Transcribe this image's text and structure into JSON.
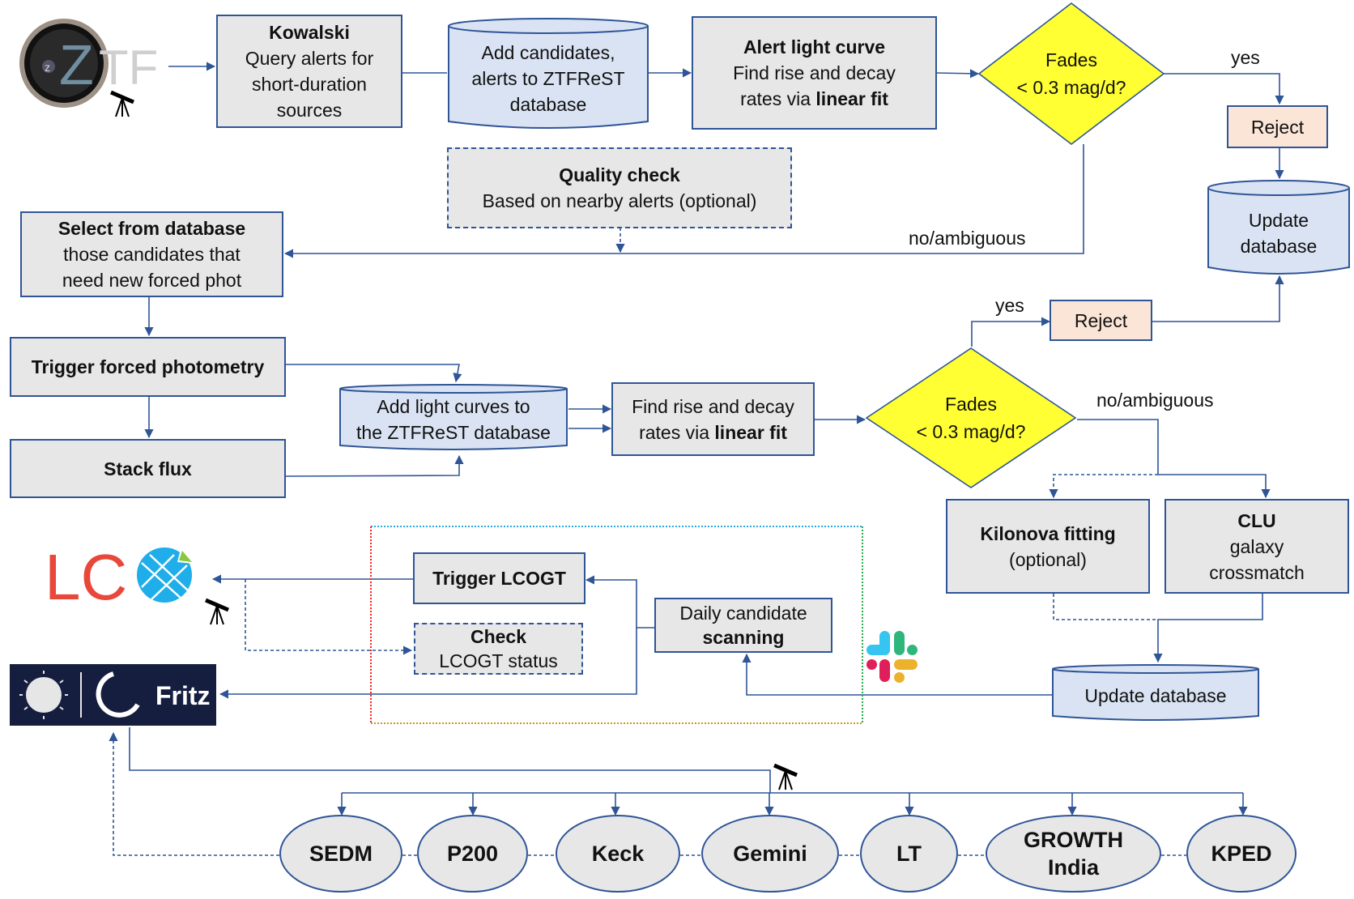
{
  "logos": {
    "ztf": {
      "name": "ZTF",
      "text_main": "Z",
      "text_rest": "TF",
      "text_small": "z"
    },
    "lco": {
      "name": "LCO",
      "text": "LC"
    },
    "fritz": {
      "name": "Fritz",
      "text": "Fritz"
    },
    "slack": {
      "name": "Slack"
    }
  },
  "nodes": {
    "kowalski": {
      "title": "Kowalski",
      "lines": [
        "Query alerts for",
        "short-duration",
        "sources"
      ]
    },
    "add_candidates": {
      "lines": [
        "Add candidates,",
        "alerts to ZTFReST",
        "database"
      ]
    },
    "alert_light_curve": {
      "title": "Alert light curve",
      "line1": "Find rise and decay",
      "line2_prefix": "rates via ",
      "line2_bold": "linear fit"
    },
    "decision_top": {
      "line1": "Fades",
      "line2": "< 0.3 mag/d?"
    },
    "reject_top": {
      "label": "Reject"
    },
    "update_db_top": {
      "lines": [
        "Update",
        "database"
      ]
    },
    "quality_check": {
      "title": "Quality check",
      "subtitle": "Based on nearby alerts (optional)"
    },
    "select_db": {
      "title": "Select from database",
      "lines": [
        "those candidates that",
        "need new forced phot"
      ]
    },
    "trigger_forced": {
      "title": "Trigger forced photometry"
    },
    "stack_flux": {
      "title": "Stack flux"
    },
    "add_light_curves": {
      "lines": [
        "Add light curves to",
        "the ZTFReST database"
      ]
    },
    "find_rise": {
      "line1": "Find rise and decay",
      "line2_prefix": "rates via ",
      "line2_bold": "linear fit"
    },
    "decision_mid": {
      "line1": "Fades",
      "line2": "< 0.3 mag/d?"
    },
    "reject_mid": {
      "label": "Reject"
    },
    "kilonova": {
      "title": "Kilonova fitting",
      "subtitle": "(optional)"
    },
    "clu": {
      "title": "CLU",
      "lines": [
        "galaxy",
        "crossmatch"
      ]
    },
    "update_db_bottom": {
      "label": "Update database"
    },
    "trigger_lcogt": {
      "title": "Trigger LCOGT"
    },
    "check_lcogt": {
      "title": "Check",
      "subtitle": "LCOGT status"
    },
    "daily_scanning": {
      "line1": "Daily candidate",
      "line2": "scanning"
    }
  },
  "edge_labels": {
    "yes_top": "yes",
    "no_top": "no/ambiguous",
    "yes_mid": "yes",
    "no_mid": "no/ambiguous"
  },
  "telescopes": [
    {
      "label": "SEDM"
    },
    {
      "label": "P200"
    },
    {
      "label": "Keck"
    },
    {
      "label": "Gemini"
    },
    {
      "label": "LT"
    },
    {
      "label": "GROWTH",
      "label2": "India"
    },
    {
      "label": "KPED"
    }
  ],
  "colors": {
    "line": "#2f5597",
    "box_fill": "#e7e7e7",
    "db_fill": "#dae3f3",
    "reject_fill": "#fbe5d6",
    "decision_fill": "#ffff33",
    "lco_red": "#e8473a",
    "lco_blue": "#1faee9",
    "fritz_bg": "#161e40"
  }
}
